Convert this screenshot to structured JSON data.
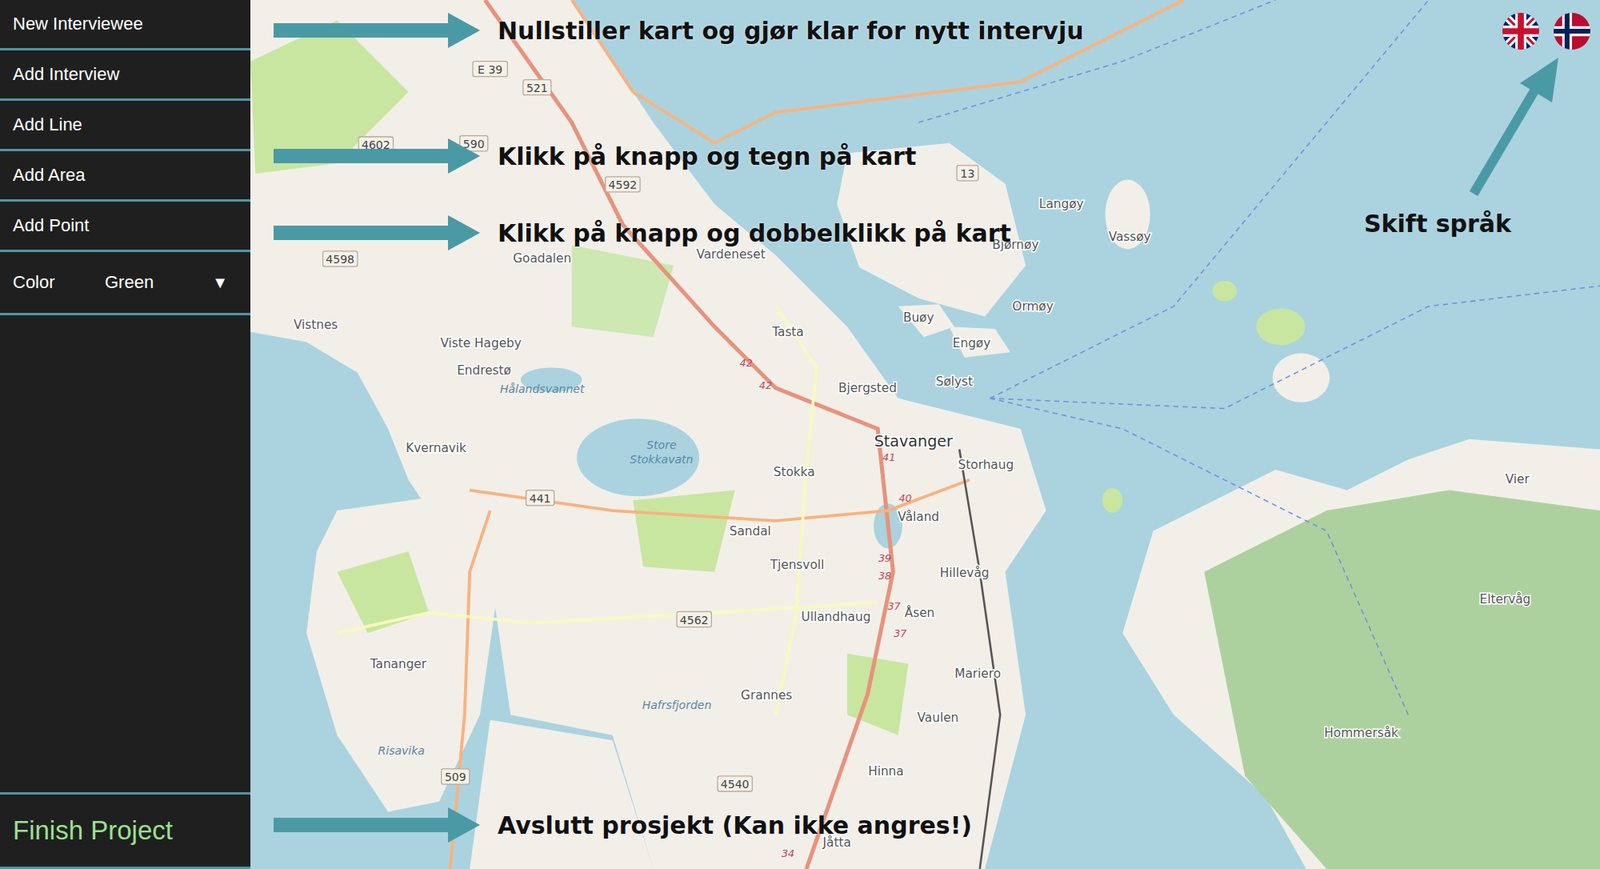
{
  "sidebar": {
    "items": [
      {
        "label": "New Interviewee"
      },
      {
        "label": "Add Interview"
      },
      {
        "label": "Add Line"
      },
      {
        "label": "Add Area"
      },
      {
        "label": "Add Point"
      }
    ],
    "color_select": {
      "label": "Color",
      "value": "Green",
      "caret": "▼"
    },
    "finish": "Finish Project"
  },
  "annotations": [
    {
      "text": "Nullstiller kart og gjør klar for nytt intervju"
    },
    {
      "text": "Klikk på knapp og tegn på kart"
    },
    {
      "text": "Klikk på knapp og dobbelklikk på kart"
    },
    {
      "text": "Avslutt prosjekt (Kan ikke angres!)"
    }
  ],
  "language": {
    "hint": "Skift språk",
    "flags": [
      {
        "kind": "uk"
      },
      {
        "kind": "no"
      }
    ]
  },
  "map": {
    "labels": [
      {
        "text": "Langøy",
        "kind": "place"
      },
      {
        "text": "Vassøy",
        "kind": "place"
      },
      {
        "text": "Bjørnøy",
        "kind": "place"
      },
      {
        "text": "Ormøy",
        "kind": "place"
      },
      {
        "text": "Buøy",
        "kind": "place"
      },
      {
        "text": "Engøy",
        "kind": "place"
      },
      {
        "text": "Sølyst",
        "kind": "place"
      },
      {
        "text": "Goadalen",
        "kind": "place"
      },
      {
        "text": "Vardeneset",
        "kind": "place"
      },
      {
        "text": "Vistnes",
        "kind": "place"
      },
      {
        "text": "Viste Hageby",
        "kind": "place"
      },
      {
        "text": "Endrestø",
        "kind": "place"
      },
      {
        "text": "Tasta",
        "kind": "place"
      },
      {
        "text": "Bjergsted",
        "kind": "place"
      },
      {
        "text": "Stavanger",
        "kind": "city"
      },
      {
        "text": "Storhaug",
        "kind": "place"
      },
      {
        "text": "Kvernavik",
        "kind": "place"
      },
      {
        "text": "Stokka",
        "kind": "place"
      },
      {
        "text": "Våland",
        "kind": "place"
      },
      {
        "text": "Sandal",
        "kind": "place"
      },
      {
        "text": "Tjensvoll",
        "kind": "place"
      },
      {
        "text": "Hillevåg",
        "kind": "place"
      },
      {
        "text": "Ullandhaug",
        "kind": "place"
      },
      {
        "text": "Åsen",
        "kind": "place"
      },
      {
        "text": "Tananger",
        "kind": "place"
      },
      {
        "text": "Mariero",
        "kind": "place"
      },
      {
        "text": "Grannes",
        "kind": "place"
      },
      {
        "text": "Vaulen",
        "kind": "place"
      },
      {
        "text": "Hinna",
        "kind": "place"
      },
      {
        "text": "Jåtta",
        "kind": "place"
      },
      {
        "text": "Vier",
        "kind": "place"
      },
      {
        "text": "Eltervåg",
        "kind": "place"
      },
      {
        "text": "Hommersåk",
        "kind": "place"
      },
      {
        "text": "Hålandsvannet",
        "kind": "water"
      },
      {
        "text": "Store",
        "kind": "water"
      },
      {
        "text": "Stokkavatn",
        "kind": "water"
      },
      {
        "text": "Hafrsfjorden",
        "kind": "water"
      },
      {
        "text": "Risavika",
        "kind": "water"
      },
      {
        "text": "E 39",
        "kind": "shield"
      },
      {
        "text": "521",
        "kind": "shield"
      },
      {
        "text": "4602",
        "kind": "shield"
      },
      {
        "text": "590",
        "kind": "shield"
      },
      {
        "text": "4592",
        "kind": "shield"
      },
      {
        "text": "13",
        "kind": "shield"
      },
      {
        "text": "4598",
        "kind": "shield"
      },
      {
        "text": "441",
        "kind": "shield"
      },
      {
        "text": "4562",
        "kind": "shield"
      },
      {
        "text": "509",
        "kind": "shield"
      },
      {
        "text": "4540",
        "kind": "shield"
      },
      {
        "text": "42",
        "kind": "route"
      },
      {
        "text": "42",
        "kind": "route"
      },
      {
        "text": "41",
        "kind": "route"
      },
      {
        "text": "40",
        "kind": "route"
      },
      {
        "text": "39",
        "kind": "route"
      },
      {
        "text": "38",
        "kind": "route"
      },
      {
        "text": "37",
        "kind": "route"
      },
      {
        "text": "37",
        "kind": "route"
      },
      {
        "text": "34",
        "kind": "route"
      }
    ]
  }
}
